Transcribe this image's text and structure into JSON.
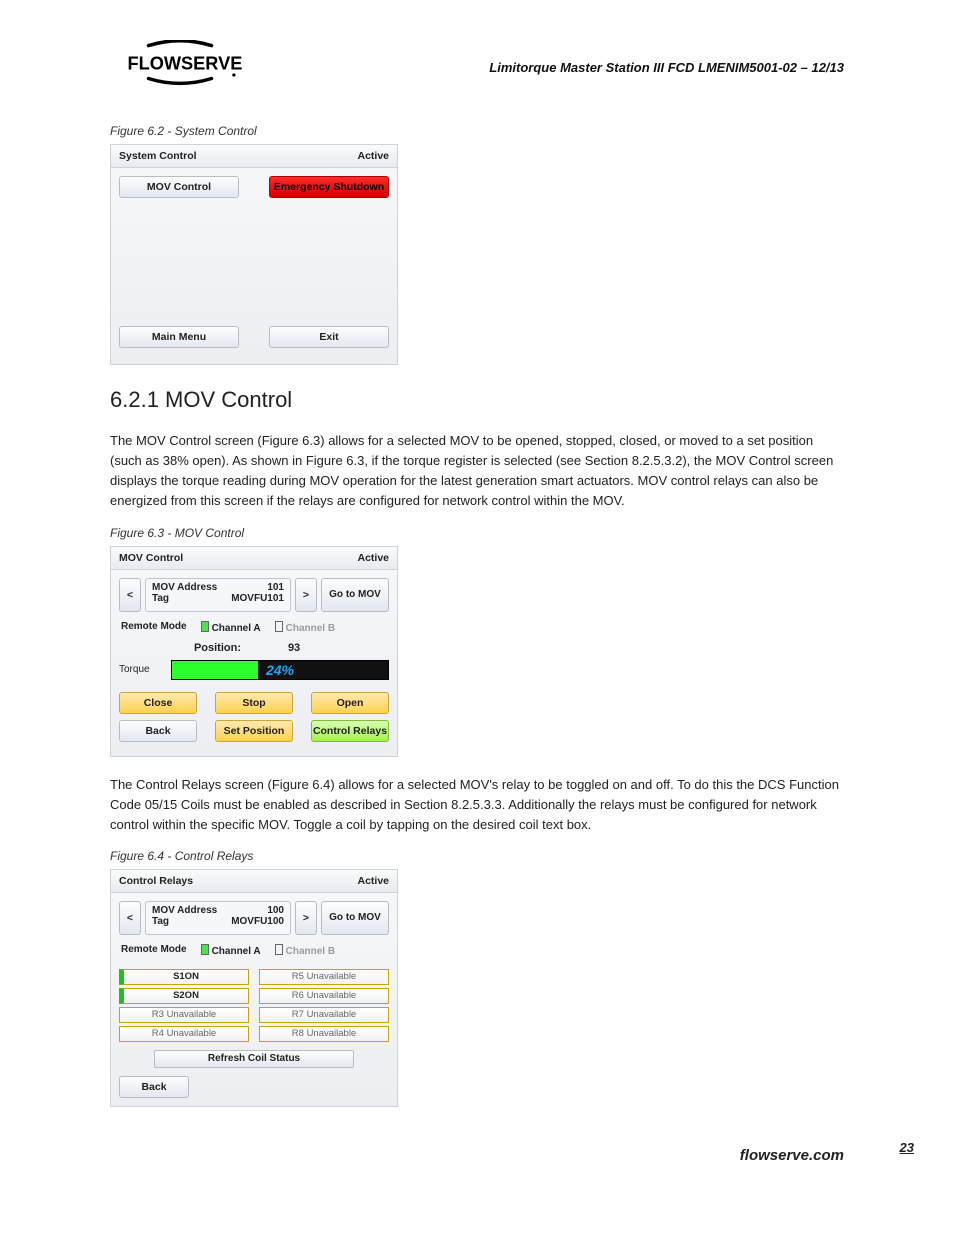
{
  "header": {
    "brand": "FLOWSERVE",
    "doc_title": "Limitorque Master Station III   FCD LMENIM5001-02 – 12/13"
  },
  "fig62": {
    "caption": "Figure 6.2 - System Control",
    "title": "System Control",
    "status": "Active",
    "mov_control": "MOV Control",
    "emergency": "Emergency Shutdown",
    "main_menu": "Main Menu",
    "exit": "Exit"
  },
  "section": {
    "heading": "6.2.1 MOV Control",
    "para1": "The MOV Control screen (Figure 6.3) allows for a selected MOV to be opened, stopped, closed, or moved to a set position (such as 38% open). As shown in Figure 6.3, if the torque register is selected (see Section 8.2.5.3.2), the MOV Control screen displays the torque reading during MOV operation for the latest generation smart actuators. MOV control relays can also be energized from this screen if the relays are configured for network control within the MOV."
  },
  "fig63": {
    "caption": "Figure 6.3 - MOV Control",
    "title": "MOV Control",
    "status": "Active",
    "addr_label": "MOV Address",
    "addr_val": "101",
    "tag_label": "Tag",
    "tag_val": "MOVFU101",
    "prev": "<",
    "next": ">",
    "goto": "Go to MOV",
    "remote": "Remote Mode",
    "chA": "Channel A",
    "chB": "Channel B",
    "pos_label": "Position:",
    "pos_val": "93",
    "torque_label": "Torque",
    "torque_pct": "24%",
    "close": "Close",
    "stop": "Stop",
    "open": "Open",
    "back": "Back",
    "setpos": "Set Position",
    "ctrlrelays": "Control Relays"
  },
  "para2": "The Control Relays screen (Figure 6.4) allows for a selected MOV's relay to be toggled on and off. To do this the DCS Function Code 05/15 Coils must be enabled as described in Section 8.2.5.3.3. Additionally the relays must be configured for network control within the specific MOV. Toggle a coil by tapping on the desired coil text box.",
  "fig64": {
    "caption": "Figure 6.4 - Control Relays",
    "title": "Control Relays",
    "status": "Active",
    "addr_label": "MOV Address",
    "addr_val": "100",
    "tag_label": "Tag",
    "tag_val": "MOVFU100",
    "prev": "<",
    "next": ">",
    "goto": "Go to MOV",
    "remote": "Remote Mode",
    "chA": "Channel A",
    "chB": "Channel B",
    "relays": {
      "r1": "S1ON",
      "r2": "S2ON",
      "r3": "R3 Unavailable",
      "r4": "R4 Unavailable",
      "r5": "R5 Unavailable",
      "r6": "R6 Unavailable",
      "r7": "R7 Unavailable",
      "r8": "R8 Unavailable"
    },
    "refresh": "Refresh Coil Status",
    "back": "Back"
  },
  "page_number": "23",
  "footer": "flowserve.com"
}
